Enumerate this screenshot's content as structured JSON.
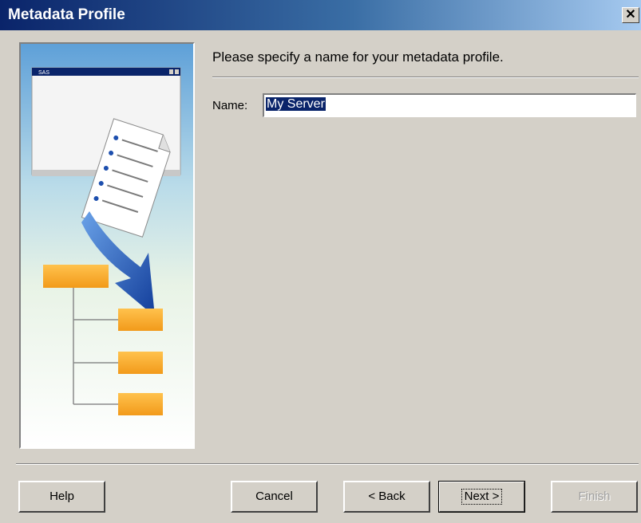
{
  "window": {
    "title": "Metadata Profile",
    "close_glyph": "✕"
  },
  "main": {
    "prompt": "Please specify a name for your metadata profile.",
    "name_label": "Name:",
    "name_value": "My Server"
  },
  "art": {
    "mini_window_title": "SAS"
  },
  "buttons": {
    "help": "Help",
    "cancel": "Cancel",
    "back": "< Back",
    "next": "Next >",
    "finish": "Finish"
  },
  "colors": {
    "titlebar_start": "#0a246a",
    "selection": "#0a246a",
    "accent_orange": "#f5a623",
    "arrow_blue": "#1d4fae"
  },
  "icons": {
    "close": "close-icon"
  }
}
